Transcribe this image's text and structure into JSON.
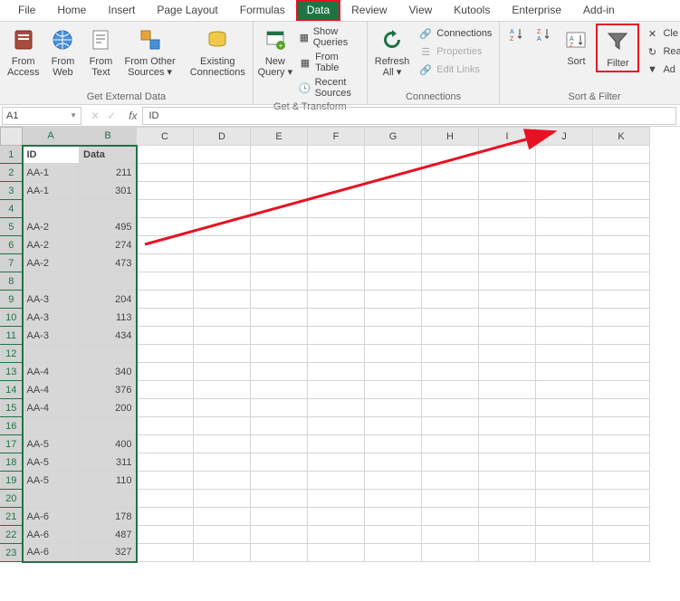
{
  "tabs": [
    "File",
    "Home",
    "Insert",
    "Page Layout",
    "Formulas",
    "Data",
    "Review",
    "View",
    "Kutools",
    "Enterprise",
    "Add-in"
  ],
  "active_tab": "Data",
  "ribbon": {
    "ext_data": {
      "label": "Get External Data",
      "from_access": "From\nAccess",
      "from_web": "From\nWeb",
      "from_text": "From\nText",
      "from_other": "From Other\nSources",
      "existing": "Existing\nConnections"
    },
    "get_transform": {
      "label": "Get & Transform",
      "new_query": "New\nQuery",
      "show_queries": "Show Queries",
      "from_table": "From Table",
      "recent_sources": "Recent Sources"
    },
    "connections": {
      "label": "Connections",
      "refresh_all": "Refresh\nAll",
      "connections": "Connections",
      "properties": "Properties",
      "edit_links": "Edit Links"
    },
    "sort_filter": {
      "label": "Sort & Filter",
      "sort": "Sort",
      "filter": "Filter",
      "clear": "Cle",
      "reapply": "Rea",
      "advanced": "Ad"
    }
  },
  "formula_bar": {
    "name_box": "A1",
    "formula": "ID"
  },
  "columns": [
    "A",
    "B",
    "C",
    "D",
    "E",
    "F",
    "G",
    "H",
    "I",
    "J",
    "K"
  ],
  "chart_data": {
    "type": "table",
    "headers": [
      "ID",
      "Data"
    ],
    "rows": [
      [
        "AA-1",
        211
      ],
      [
        "AA-1",
        301
      ],
      [
        "",
        ""
      ],
      [
        "AA-2",
        495
      ],
      [
        "AA-2",
        274
      ],
      [
        "AA-2",
        473
      ],
      [
        "",
        ""
      ],
      [
        "AA-3",
        204
      ],
      [
        "AA-3",
        113
      ],
      [
        "AA-3",
        434
      ],
      [
        "",
        ""
      ],
      [
        "AA-4",
        340
      ],
      [
        "AA-4",
        376
      ],
      [
        "AA-4",
        200
      ],
      [
        "",
        ""
      ],
      [
        "AA-5",
        400
      ],
      [
        "AA-5",
        311
      ],
      [
        "AA-5",
        110
      ],
      [
        "",
        ""
      ],
      [
        "AA-6",
        178
      ],
      [
        "AA-6",
        487
      ],
      [
        "AA-6",
        327
      ]
    ]
  }
}
